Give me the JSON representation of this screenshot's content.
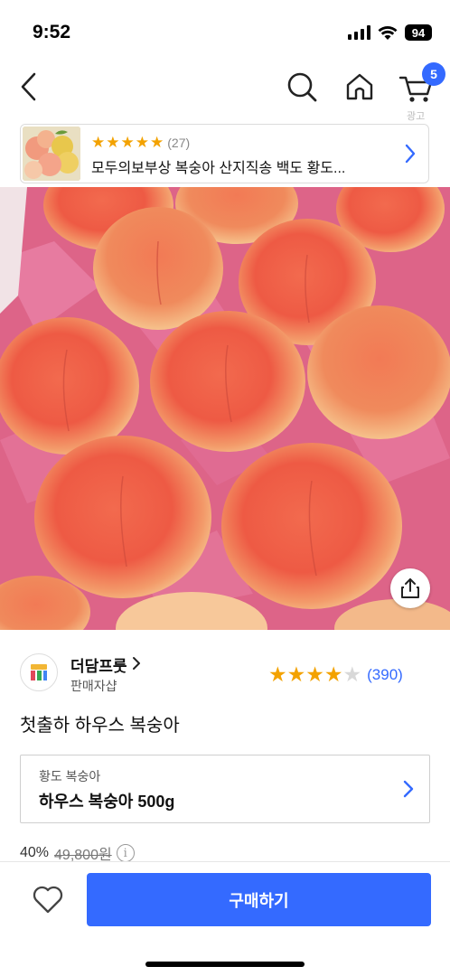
{
  "status_bar": {
    "time": "9:52",
    "battery": "94"
  },
  "nav": {
    "cart_count": "5",
    "ad_label": "광고"
  },
  "ad_banner": {
    "rating_count": "(27)",
    "stars": 5,
    "title": "모두의보부상 복숭아 산지직송 백도 황도..."
  },
  "seller": {
    "name": "더담프룻",
    "subtitle": "판매자샵",
    "rating_stars": 4,
    "rating_count": "(390)"
  },
  "product": {
    "title": "첫출하 하우스 복숭아"
  },
  "option": {
    "label": "황도 복숭아",
    "value": "하우스 복숭아 500g"
  },
  "price": {
    "discount": "40%",
    "original": "49,800원"
  },
  "bottom_bar": {
    "buy_label": "구매하기"
  },
  "colors": {
    "accent": "#346aff",
    "star": "#f3a200"
  },
  "icons": [
    "back-icon",
    "search-icon",
    "home-icon",
    "cart-icon",
    "chevron-right-icon",
    "share-icon",
    "heart-icon",
    "info-icon",
    "signal-icon",
    "wifi-icon",
    "battery-icon"
  ]
}
